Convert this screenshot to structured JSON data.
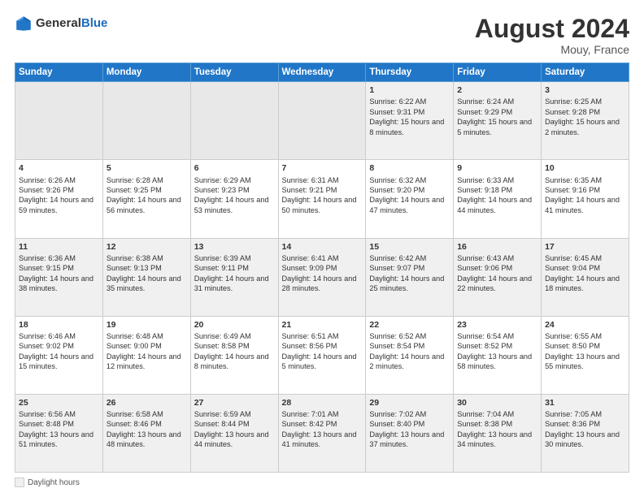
{
  "header": {
    "logo_general": "General",
    "logo_blue": "Blue",
    "main_title": "August 2024",
    "subtitle": "Mouy, France"
  },
  "days_of_week": [
    "Sunday",
    "Monday",
    "Tuesday",
    "Wednesday",
    "Thursday",
    "Friday",
    "Saturday"
  ],
  "weeks": [
    [
      {
        "day": "",
        "empty": true
      },
      {
        "day": "",
        "empty": true
      },
      {
        "day": "",
        "empty": true
      },
      {
        "day": "",
        "empty": true
      },
      {
        "day": "1",
        "sunrise": "Sunrise: 6:22 AM",
        "sunset": "Sunset: 9:31 PM",
        "daylight": "Daylight: 15 hours and 8 minutes."
      },
      {
        "day": "2",
        "sunrise": "Sunrise: 6:24 AM",
        "sunset": "Sunset: 9:29 PM",
        "daylight": "Daylight: 15 hours and 5 minutes."
      },
      {
        "day": "3",
        "sunrise": "Sunrise: 6:25 AM",
        "sunset": "Sunset: 9:28 PM",
        "daylight": "Daylight: 15 hours and 2 minutes."
      }
    ],
    [
      {
        "day": "4",
        "sunrise": "Sunrise: 6:26 AM",
        "sunset": "Sunset: 9:26 PM",
        "daylight": "Daylight: 14 hours and 59 minutes."
      },
      {
        "day": "5",
        "sunrise": "Sunrise: 6:28 AM",
        "sunset": "Sunset: 9:25 PM",
        "daylight": "Daylight: 14 hours and 56 minutes."
      },
      {
        "day": "6",
        "sunrise": "Sunrise: 6:29 AM",
        "sunset": "Sunset: 9:23 PM",
        "daylight": "Daylight: 14 hours and 53 minutes."
      },
      {
        "day": "7",
        "sunrise": "Sunrise: 6:31 AM",
        "sunset": "Sunset: 9:21 PM",
        "daylight": "Daylight: 14 hours and 50 minutes."
      },
      {
        "day": "8",
        "sunrise": "Sunrise: 6:32 AM",
        "sunset": "Sunset: 9:20 PM",
        "daylight": "Daylight: 14 hours and 47 minutes."
      },
      {
        "day": "9",
        "sunrise": "Sunrise: 6:33 AM",
        "sunset": "Sunset: 9:18 PM",
        "daylight": "Daylight: 14 hours and 44 minutes."
      },
      {
        "day": "10",
        "sunrise": "Sunrise: 6:35 AM",
        "sunset": "Sunset: 9:16 PM",
        "daylight": "Daylight: 14 hours and 41 minutes."
      }
    ],
    [
      {
        "day": "11",
        "sunrise": "Sunrise: 6:36 AM",
        "sunset": "Sunset: 9:15 PM",
        "daylight": "Daylight: 14 hours and 38 minutes."
      },
      {
        "day": "12",
        "sunrise": "Sunrise: 6:38 AM",
        "sunset": "Sunset: 9:13 PM",
        "daylight": "Daylight: 14 hours and 35 minutes."
      },
      {
        "day": "13",
        "sunrise": "Sunrise: 6:39 AM",
        "sunset": "Sunset: 9:11 PM",
        "daylight": "Daylight: 14 hours and 31 minutes."
      },
      {
        "day": "14",
        "sunrise": "Sunrise: 6:41 AM",
        "sunset": "Sunset: 9:09 PM",
        "daylight": "Daylight: 14 hours and 28 minutes."
      },
      {
        "day": "15",
        "sunrise": "Sunrise: 6:42 AM",
        "sunset": "Sunset: 9:07 PM",
        "daylight": "Daylight: 14 hours and 25 minutes."
      },
      {
        "day": "16",
        "sunrise": "Sunrise: 6:43 AM",
        "sunset": "Sunset: 9:06 PM",
        "daylight": "Daylight: 14 hours and 22 minutes."
      },
      {
        "day": "17",
        "sunrise": "Sunrise: 6:45 AM",
        "sunset": "Sunset: 9:04 PM",
        "daylight": "Daylight: 14 hours and 18 minutes."
      }
    ],
    [
      {
        "day": "18",
        "sunrise": "Sunrise: 6:46 AM",
        "sunset": "Sunset: 9:02 PM",
        "daylight": "Daylight: 14 hours and 15 minutes."
      },
      {
        "day": "19",
        "sunrise": "Sunrise: 6:48 AM",
        "sunset": "Sunset: 9:00 PM",
        "daylight": "Daylight: 14 hours and 12 minutes."
      },
      {
        "day": "20",
        "sunrise": "Sunrise: 6:49 AM",
        "sunset": "Sunset: 8:58 PM",
        "daylight": "Daylight: 14 hours and 8 minutes."
      },
      {
        "day": "21",
        "sunrise": "Sunrise: 6:51 AM",
        "sunset": "Sunset: 8:56 PM",
        "daylight": "Daylight: 14 hours and 5 minutes."
      },
      {
        "day": "22",
        "sunrise": "Sunrise: 6:52 AM",
        "sunset": "Sunset: 8:54 PM",
        "daylight": "Daylight: 14 hours and 2 minutes."
      },
      {
        "day": "23",
        "sunrise": "Sunrise: 6:54 AM",
        "sunset": "Sunset: 8:52 PM",
        "daylight": "Daylight: 13 hours and 58 minutes."
      },
      {
        "day": "24",
        "sunrise": "Sunrise: 6:55 AM",
        "sunset": "Sunset: 8:50 PM",
        "daylight": "Daylight: 13 hours and 55 minutes."
      }
    ],
    [
      {
        "day": "25",
        "sunrise": "Sunrise: 6:56 AM",
        "sunset": "Sunset: 8:48 PM",
        "daylight": "Daylight: 13 hours and 51 minutes."
      },
      {
        "day": "26",
        "sunrise": "Sunrise: 6:58 AM",
        "sunset": "Sunset: 8:46 PM",
        "daylight": "Daylight: 13 hours and 48 minutes."
      },
      {
        "day": "27",
        "sunrise": "Sunrise: 6:59 AM",
        "sunset": "Sunset: 8:44 PM",
        "daylight": "Daylight: 13 hours and 44 minutes."
      },
      {
        "day": "28",
        "sunrise": "Sunrise: 7:01 AM",
        "sunset": "Sunset: 8:42 PM",
        "daylight": "Daylight: 13 hours and 41 minutes."
      },
      {
        "day": "29",
        "sunrise": "Sunrise: 7:02 AM",
        "sunset": "Sunset: 8:40 PM",
        "daylight": "Daylight: 13 hours and 37 minutes."
      },
      {
        "day": "30",
        "sunrise": "Sunrise: 7:04 AM",
        "sunset": "Sunset: 8:38 PM",
        "daylight": "Daylight: 13 hours and 34 minutes."
      },
      {
        "day": "31",
        "sunrise": "Sunrise: 7:05 AM",
        "sunset": "Sunset: 8:36 PM",
        "daylight": "Daylight: 13 hours and 30 minutes."
      }
    ]
  ],
  "footer": {
    "legend_label": "Daylight hours"
  }
}
